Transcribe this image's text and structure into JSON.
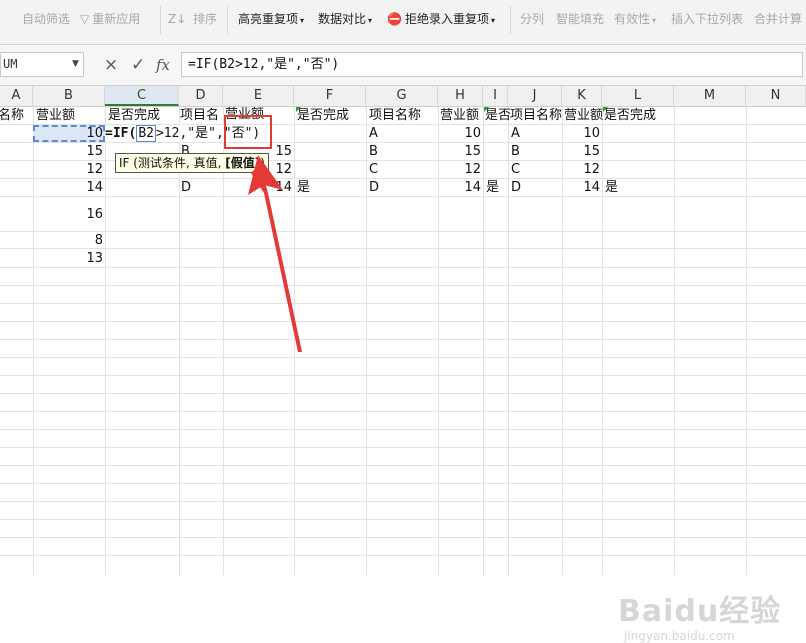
{
  "ribbon": {
    "auto_filter": "自动筛选",
    "reapply": "重新应用",
    "sort": "排序",
    "highlight_dup": "高亮重复项",
    "data_compare": "数据对比",
    "reject_dup": "拒绝录入重复项",
    "split": "分列",
    "smart_fill": "智能填充",
    "validity": "有效性",
    "insert_dropdown": "插入下拉列表",
    "merge_calc": "合并计算"
  },
  "formula_bar": {
    "name_box": "UM",
    "cancel": "×",
    "confirm": "✓",
    "fx": "fx",
    "formula": "=IF(B2>12,\"是\",\"否\")"
  },
  "columns": [
    "A",
    "B",
    "C",
    "D",
    "E",
    "F",
    "G",
    "H",
    "I",
    "J",
    "K",
    "L",
    "M",
    "N"
  ],
  "cells": {
    "A1": "名称",
    "B1": "营业额",
    "C1": "是否完成",
    "D1": "项目名",
    "E1": "营业额",
    "F1": "是否完成",
    "G1": "项目名称",
    "H1": "营业额",
    "I1": "是否",
    "J1": "项目名称",
    "K1": "营业额",
    "L1": "是否完成",
    "B_values": [
      "10",
      "15",
      "12",
      "14",
      "16",
      "8",
      "13"
    ],
    "D_values": [
      "B",
      "C",
      "D"
    ],
    "E_values": [
      "15",
      "12",
      "14"
    ],
    "F5": "是",
    "G_values": [
      "A",
      "B",
      "C",
      "D"
    ],
    "H_values": [
      "10",
      "15",
      "12",
      "14"
    ],
    "I5": "是",
    "J_values": [
      "A",
      "B",
      "C",
      "D"
    ],
    "K_values": [
      "10",
      "15",
      "12",
      "14"
    ],
    "L5": "是"
  },
  "editing": {
    "prefix": "=IF(",
    "ref": "B2",
    "suffix1": ">12,\"是\"",
    "suffix2": ",\"否\")"
  },
  "tooltip": {
    "text": "IF (测试条件, 真值, ",
    "bold": "[假值]",
    "close": ")"
  },
  "annotation": {
    "color": "#e53935"
  },
  "watermark": {
    "brand": "Baidu经验",
    "url": "jingyan.baidu.com"
  }
}
